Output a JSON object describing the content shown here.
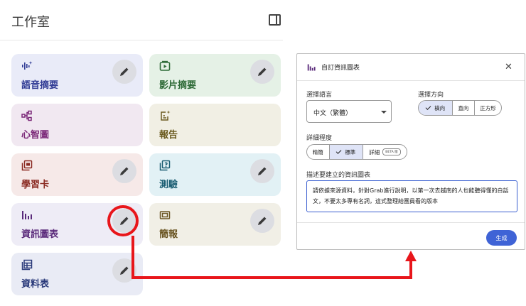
{
  "studio": {
    "title": "工作室",
    "cards": [
      {
        "label": "語音摘要",
        "icon": "audio-wave-icon"
      },
      {
        "label": "影片摘要",
        "icon": "video-play-icon"
      },
      {
        "label": "心智圖",
        "icon": "mind-map-icon"
      },
      {
        "label": "報告",
        "icon": "report-icon"
      },
      {
        "label": "學習卡",
        "icon": "flashcard-icon"
      },
      {
        "label": "測驗",
        "icon": "quiz-icon"
      },
      {
        "label": "資訊圖表",
        "icon": "infographic-icon"
      },
      {
        "label": "簡報",
        "icon": "slides-icon"
      },
      {
        "label": "資料表",
        "icon": "data-table-icon"
      }
    ]
  },
  "dialog": {
    "title": "自訂資訊圖表",
    "language_label": "選擇語言",
    "language_value": "中文（繁體）",
    "orientation_label": "選擇方向",
    "orientation_options": [
      "橫向",
      "直向",
      "正方形"
    ],
    "orientation_selected": "橫向",
    "detail_label": "詳細程度",
    "detail_options": [
      "精簡",
      "標準",
      "詳細"
    ],
    "detail_selected": "標準",
    "beta_badge": "BETA 版",
    "describe_label": "描述要建立的資訊圖表",
    "describe_value": "請依據來源資料，針對Grab進行說明，以第一次去越南的人也能聽得懂的白話文，不要太多專有名詞，這式整理給團員看的版本",
    "generate_button": "生成"
  },
  "colors": {
    "annotation_red": "#e8161b",
    "accent_blue": "#3f63d6"
  }
}
